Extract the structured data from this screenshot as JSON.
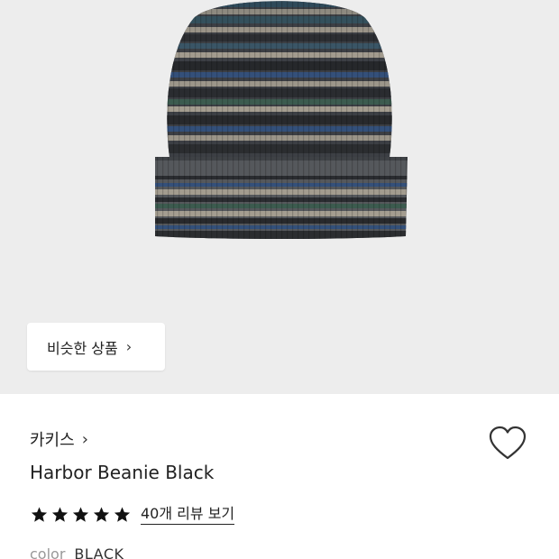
{
  "product": {
    "image_icon": "striped-beanie-image",
    "similar_button_label": "비슷한 상품",
    "brand": "카키스",
    "name": "Harbor Beanie Black",
    "rating_stars": 5,
    "review_link": "40개 리뷰 보기",
    "color_label": "color",
    "color_value": "BLACK"
  },
  "icons": {
    "chevron": "chevron-right-icon",
    "wishlist": "heart-outline-icon",
    "star": "star-filled-icon"
  },
  "colors": {
    "hero_background": "#ededed",
    "text_primary": "#222222",
    "text_muted": "#999999"
  }
}
